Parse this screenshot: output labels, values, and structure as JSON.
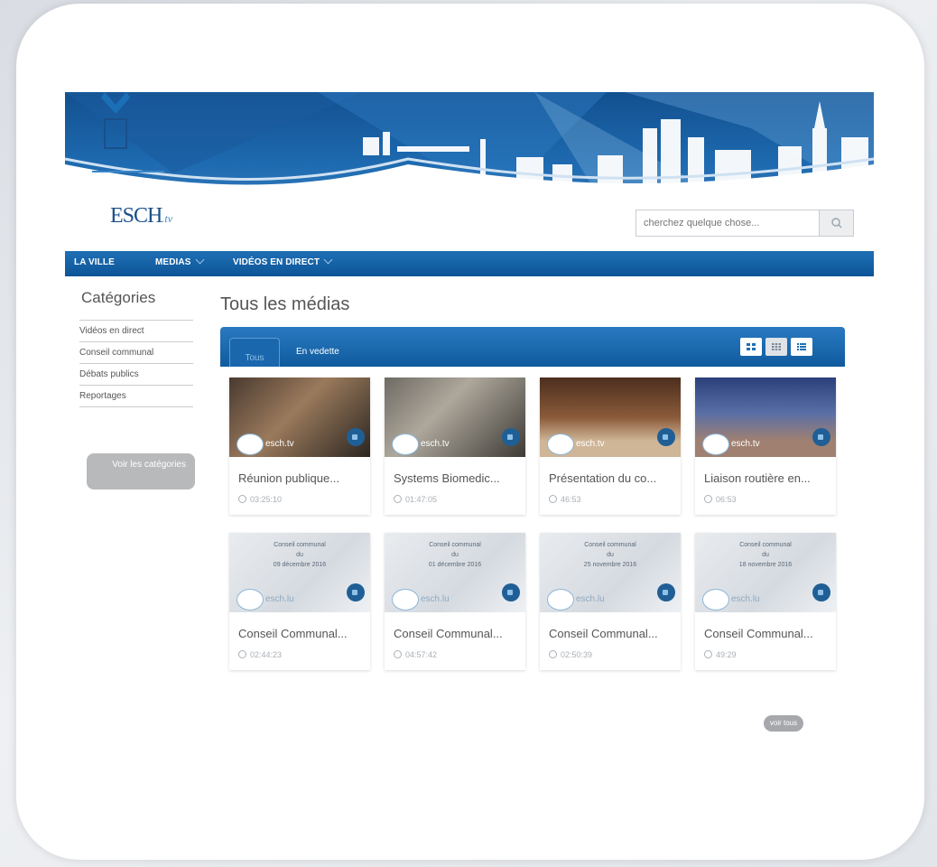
{
  "search": {
    "placeholder": "cherchez quelque chose..."
  },
  "logo": {
    "text": "ESCH",
    "suffix": ".tv"
  },
  "nav": {
    "items": [
      {
        "label": "LA VILLE"
      },
      {
        "label": "MEDIAS"
      },
      {
        "label": "VIDÉOS EN DIRECT"
      }
    ]
  },
  "sidebar": {
    "title": "Catégories",
    "items": [
      {
        "label": "Vidéos en direct"
      },
      {
        "label": "Conseil communal"
      },
      {
        "label": "Débats publics"
      },
      {
        "label": "Reportages"
      }
    ],
    "button_label": "Voir les catégories"
  },
  "main": {
    "title": "Tous les médias",
    "tabs": [
      {
        "label": "Tous"
      },
      {
        "label": "En vedette"
      }
    ],
    "views": [
      "grid-large-icon",
      "grid-small-icon",
      "list-icon"
    ]
  },
  "media": [
    {
      "title": "Réunion publique...",
      "duration": "03:25:10",
      "brand": "esch.tv"
    },
    {
      "title": "Systems Biomedic...",
      "duration": "01:47:05",
      "brand": "esch.tv"
    },
    {
      "title": "Présentation du co...",
      "duration": "46:53",
      "brand": "esch.tv"
    },
    {
      "title": "Liaison routière en...",
      "duration": "06:53",
      "brand": "esch.tv"
    },
    {
      "title": "Conseil Communal...",
      "duration": "02:44:23",
      "brand": "esch.lu",
      "card_line1": "Conseil communal",
      "card_line2": "du",
      "card_line3": "09 décembre 2016"
    },
    {
      "title": "Conseil Communal...",
      "duration": "04:57:42",
      "brand": "esch.lu",
      "card_line1": "Conseil communal",
      "card_line2": "du",
      "card_line3": "01 décembre 2016"
    },
    {
      "title": "Conseil Communal...",
      "duration": "02:50:39",
      "brand": "esch.lu",
      "card_line1": "Conseil communal",
      "card_line2": "du",
      "card_line3": "25 novembre 2016"
    },
    {
      "title": "Conseil Communal...",
      "duration": "49:29",
      "brand": "esch.lu",
      "card_line1": "Conseil communal",
      "card_line2": "du",
      "card_line3": "18 novembre 2016"
    }
  ],
  "see_all": "voir tous",
  "colors": {
    "primary": "#0d5497",
    "accent": "#1f6fb5",
    "button_gray": "#b8b9bb"
  }
}
